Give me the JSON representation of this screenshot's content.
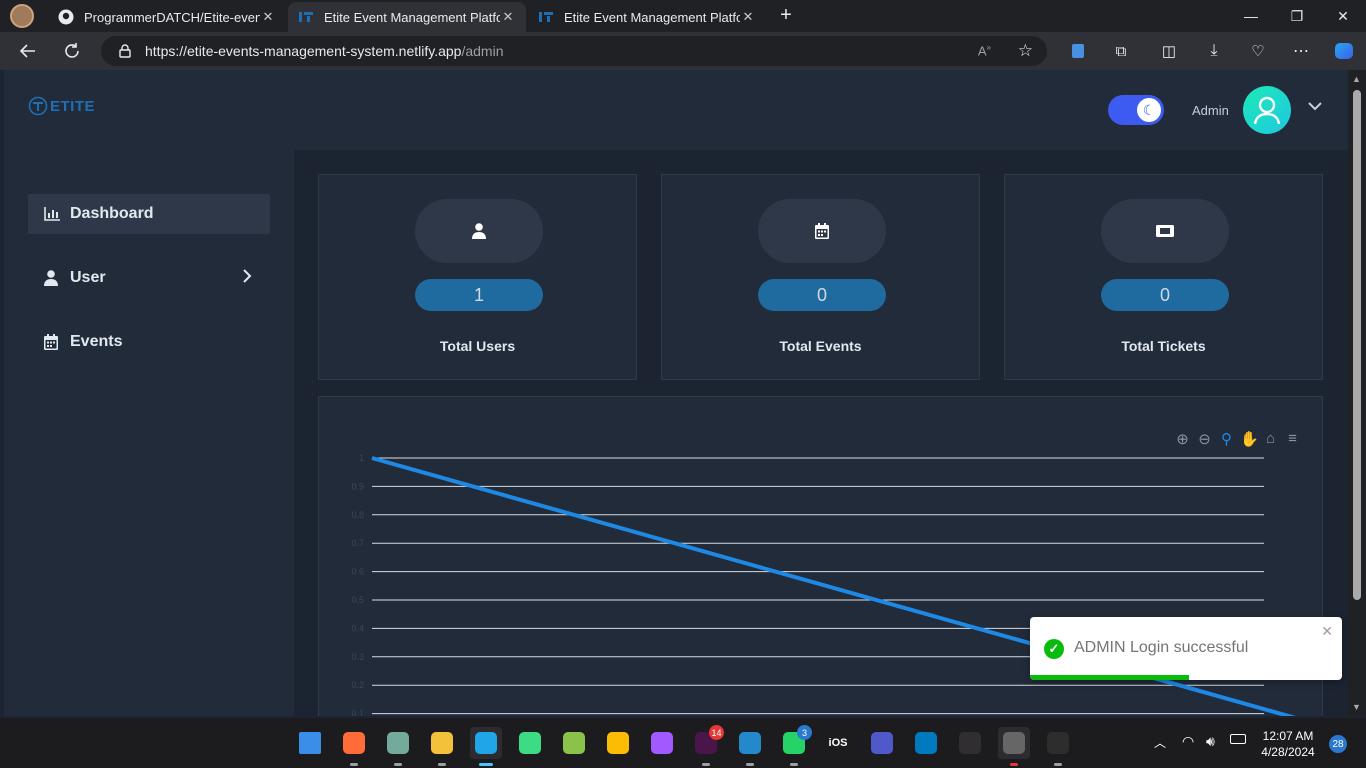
{
  "browser": {
    "tabs": [
      {
        "title": "ProgrammerDATCH/Etite-event-r",
        "icon": "github-icon"
      },
      {
        "title": "Etite Event Management Platform",
        "icon": "etite-favicon-icon"
      },
      {
        "title": "Etite Event Management Platform",
        "icon": "etite-favicon-icon"
      }
    ],
    "url_host": "https://etite-events-management-system.netlify.app",
    "url_path": "/admin"
  },
  "app": {
    "logo_text": "ETITE",
    "admin_label": "Admin",
    "sidebar": [
      {
        "label": "Dashboard",
        "icon": "bar-chart-icon"
      },
      {
        "label": "User",
        "icon": "user-icon"
      },
      {
        "label": "Events",
        "icon": "calendar-icon"
      }
    ],
    "stats": [
      {
        "value": "1",
        "label": "Total Users",
        "icon": "user-icon"
      },
      {
        "value": "0",
        "label": "Total Events",
        "icon": "calendar-icon"
      },
      {
        "value": "0",
        "label": "Total Tickets",
        "icon": "ticket-icon"
      }
    ]
  },
  "chart_data": {
    "type": "line",
    "ylim": [
      0,
      1
    ],
    "y_ticks": [
      "1",
      "0.9",
      "0.8",
      "0.7",
      "0.6",
      "0.5",
      "0.4",
      "0.3",
      "0.2",
      "0.1"
    ],
    "series": [
      {
        "color": "#1e88e5",
        "values": [
          1,
          0
        ]
      }
    ]
  },
  "toast": {
    "message": "ADMIN Login successful",
    "progress": 0.51
  },
  "taskbar": {
    "time": "12:07 AM",
    "date": "4/28/2024",
    "notifications": "28",
    "apps": [
      {
        "name": "start-icon",
        "color": "#3b8ee8",
        "badge": ""
      },
      {
        "name": "postman-icon",
        "color": "#ff6c37",
        "badge": ""
      },
      {
        "name": "chatgpt-icon",
        "color": "#74aa9c",
        "badge": ""
      },
      {
        "name": "file-explorer-icon",
        "color": "#f3c13a",
        "badge": ""
      },
      {
        "name": "edge-icon",
        "color": "#1fa5e8",
        "badge": ""
      },
      {
        "name": "android-studio-icon",
        "color": "#3ddc84",
        "badge": ""
      },
      {
        "name": "money-manager-icon",
        "color": "#8bc34a",
        "badge": ""
      },
      {
        "name": "chrome-icon",
        "color": "#fbbc05",
        "badge": ""
      },
      {
        "name": "figma-icon",
        "color": "#a259ff",
        "badge": ""
      },
      {
        "name": "slack-icon",
        "color": "#4a154b",
        "badge": "14"
      },
      {
        "name": "vscode-icon",
        "color": "#2489ca",
        "badge": ""
      },
      {
        "name": "whatsapp-icon",
        "color": "#25d366",
        "badge": "3"
      },
      {
        "name": "ios-icon",
        "color": "#333333",
        "badge": ""
      },
      {
        "name": "teams-icon",
        "color": "#5059c9",
        "badge": ""
      },
      {
        "name": "trello-icon",
        "color": "#0079bf",
        "badge": ""
      },
      {
        "name": "obs-icon",
        "color": "#302e31",
        "badge": ""
      },
      {
        "name": "settings-icon",
        "color": "#666666",
        "badge": ""
      },
      {
        "name": "terminal-icon",
        "color": "#2d2d2d",
        "badge": ""
      }
    ]
  }
}
